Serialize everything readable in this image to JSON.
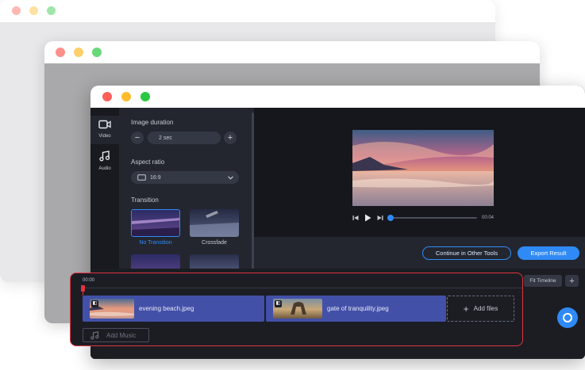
{
  "colors": {
    "accent": "#2f8af5",
    "highlight": "#e2333f",
    "traffic_red": "#ff5f57",
    "traffic_yellow": "#febc2e",
    "traffic_green": "#28c840",
    "clip": "#4350a8"
  },
  "sidebar": {
    "items": [
      {
        "label": "Video",
        "icon": "video-camera-icon"
      },
      {
        "label": "Audio",
        "icon": "music-note-icon"
      }
    ]
  },
  "settings": {
    "image_duration_label": "Image duration",
    "duration_value": "2 sec",
    "decrement": "−",
    "increment": "+",
    "aspect_ratio_label": "Aspect ratio",
    "aspect_value": "16:9",
    "transition_label": "Transition",
    "transitions": [
      {
        "label": "No Transition",
        "selected": true
      },
      {
        "label": "Crossfade",
        "selected": false
      }
    ]
  },
  "player": {
    "time": "00:04",
    "progress": 0.0
  },
  "actions": {
    "continue_label": "Continue in Other Tools",
    "export_label": "Export Result"
  },
  "timeline": {
    "timecode": "00:00",
    "fit_label": "Fit Timeline",
    "add_track": "+",
    "clips": [
      {
        "name": "evening beach.jpeg"
      },
      {
        "name": "gate of tranquility.jpeg"
      }
    ],
    "add_files_label": "Add files",
    "add_music_label": "Add Music"
  }
}
